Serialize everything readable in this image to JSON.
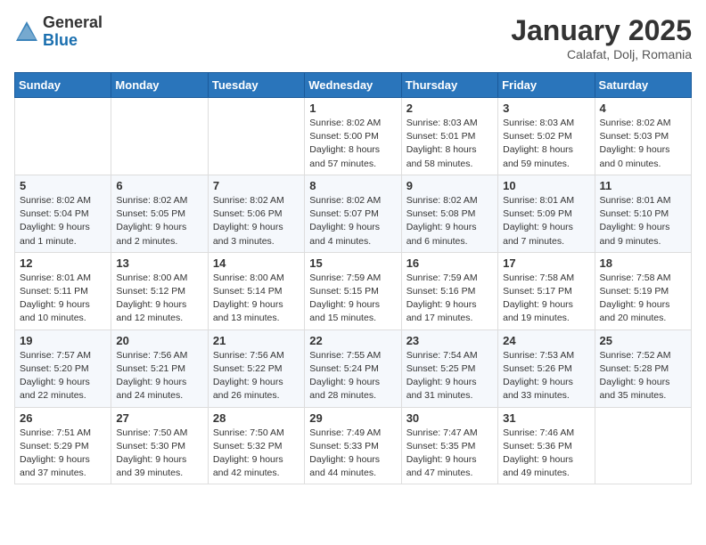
{
  "header": {
    "logo_general": "General",
    "logo_blue": "Blue",
    "month": "January 2025",
    "location": "Calafat, Dolj, Romania"
  },
  "weekdays": [
    "Sunday",
    "Monday",
    "Tuesday",
    "Wednesday",
    "Thursday",
    "Friday",
    "Saturday"
  ],
  "weeks": [
    [
      {
        "day": "",
        "info": ""
      },
      {
        "day": "",
        "info": ""
      },
      {
        "day": "",
        "info": ""
      },
      {
        "day": "1",
        "info": "Sunrise: 8:02 AM\nSunset: 5:00 PM\nDaylight: 8 hours and 57 minutes."
      },
      {
        "day": "2",
        "info": "Sunrise: 8:03 AM\nSunset: 5:01 PM\nDaylight: 8 hours and 58 minutes."
      },
      {
        "day": "3",
        "info": "Sunrise: 8:03 AM\nSunset: 5:02 PM\nDaylight: 8 hours and 59 minutes."
      },
      {
        "day": "4",
        "info": "Sunrise: 8:02 AM\nSunset: 5:03 PM\nDaylight: 9 hours and 0 minutes."
      }
    ],
    [
      {
        "day": "5",
        "info": "Sunrise: 8:02 AM\nSunset: 5:04 PM\nDaylight: 9 hours and 1 minute."
      },
      {
        "day": "6",
        "info": "Sunrise: 8:02 AM\nSunset: 5:05 PM\nDaylight: 9 hours and 2 minutes."
      },
      {
        "day": "7",
        "info": "Sunrise: 8:02 AM\nSunset: 5:06 PM\nDaylight: 9 hours and 3 minutes."
      },
      {
        "day": "8",
        "info": "Sunrise: 8:02 AM\nSunset: 5:07 PM\nDaylight: 9 hours and 4 minutes."
      },
      {
        "day": "9",
        "info": "Sunrise: 8:02 AM\nSunset: 5:08 PM\nDaylight: 9 hours and 6 minutes."
      },
      {
        "day": "10",
        "info": "Sunrise: 8:01 AM\nSunset: 5:09 PM\nDaylight: 9 hours and 7 minutes."
      },
      {
        "day": "11",
        "info": "Sunrise: 8:01 AM\nSunset: 5:10 PM\nDaylight: 9 hours and 9 minutes."
      }
    ],
    [
      {
        "day": "12",
        "info": "Sunrise: 8:01 AM\nSunset: 5:11 PM\nDaylight: 9 hours and 10 minutes."
      },
      {
        "day": "13",
        "info": "Sunrise: 8:00 AM\nSunset: 5:12 PM\nDaylight: 9 hours and 12 minutes."
      },
      {
        "day": "14",
        "info": "Sunrise: 8:00 AM\nSunset: 5:14 PM\nDaylight: 9 hours and 13 minutes."
      },
      {
        "day": "15",
        "info": "Sunrise: 7:59 AM\nSunset: 5:15 PM\nDaylight: 9 hours and 15 minutes."
      },
      {
        "day": "16",
        "info": "Sunrise: 7:59 AM\nSunset: 5:16 PM\nDaylight: 9 hours and 17 minutes."
      },
      {
        "day": "17",
        "info": "Sunrise: 7:58 AM\nSunset: 5:17 PM\nDaylight: 9 hours and 19 minutes."
      },
      {
        "day": "18",
        "info": "Sunrise: 7:58 AM\nSunset: 5:19 PM\nDaylight: 9 hours and 20 minutes."
      }
    ],
    [
      {
        "day": "19",
        "info": "Sunrise: 7:57 AM\nSunset: 5:20 PM\nDaylight: 9 hours and 22 minutes."
      },
      {
        "day": "20",
        "info": "Sunrise: 7:56 AM\nSunset: 5:21 PM\nDaylight: 9 hours and 24 minutes."
      },
      {
        "day": "21",
        "info": "Sunrise: 7:56 AM\nSunset: 5:22 PM\nDaylight: 9 hours and 26 minutes."
      },
      {
        "day": "22",
        "info": "Sunrise: 7:55 AM\nSunset: 5:24 PM\nDaylight: 9 hours and 28 minutes."
      },
      {
        "day": "23",
        "info": "Sunrise: 7:54 AM\nSunset: 5:25 PM\nDaylight: 9 hours and 31 minutes."
      },
      {
        "day": "24",
        "info": "Sunrise: 7:53 AM\nSunset: 5:26 PM\nDaylight: 9 hours and 33 minutes."
      },
      {
        "day": "25",
        "info": "Sunrise: 7:52 AM\nSunset: 5:28 PM\nDaylight: 9 hours and 35 minutes."
      }
    ],
    [
      {
        "day": "26",
        "info": "Sunrise: 7:51 AM\nSunset: 5:29 PM\nDaylight: 9 hours and 37 minutes."
      },
      {
        "day": "27",
        "info": "Sunrise: 7:50 AM\nSunset: 5:30 PM\nDaylight: 9 hours and 39 minutes."
      },
      {
        "day": "28",
        "info": "Sunrise: 7:50 AM\nSunset: 5:32 PM\nDaylight: 9 hours and 42 minutes."
      },
      {
        "day": "29",
        "info": "Sunrise: 7:49 AM\nSunset: 5:33 PM\nDaylight: 9 hours and 44 minutes."
      },
      {
        "day": "30",
        "info": "Sunrise: 7:47 AM\nSunset: 5:35 PM\nDaylight: 9 hours and 47 minutes."
      },
      {
        "day": "31",
        "info": "Sunrise: 7:46 AM\nSunset: 5:36 PM\nDaylight: 9 hours and 49 minutes."
      },
      {
        "day": "",
        "info": ""
      }
    ]
  ]
}
